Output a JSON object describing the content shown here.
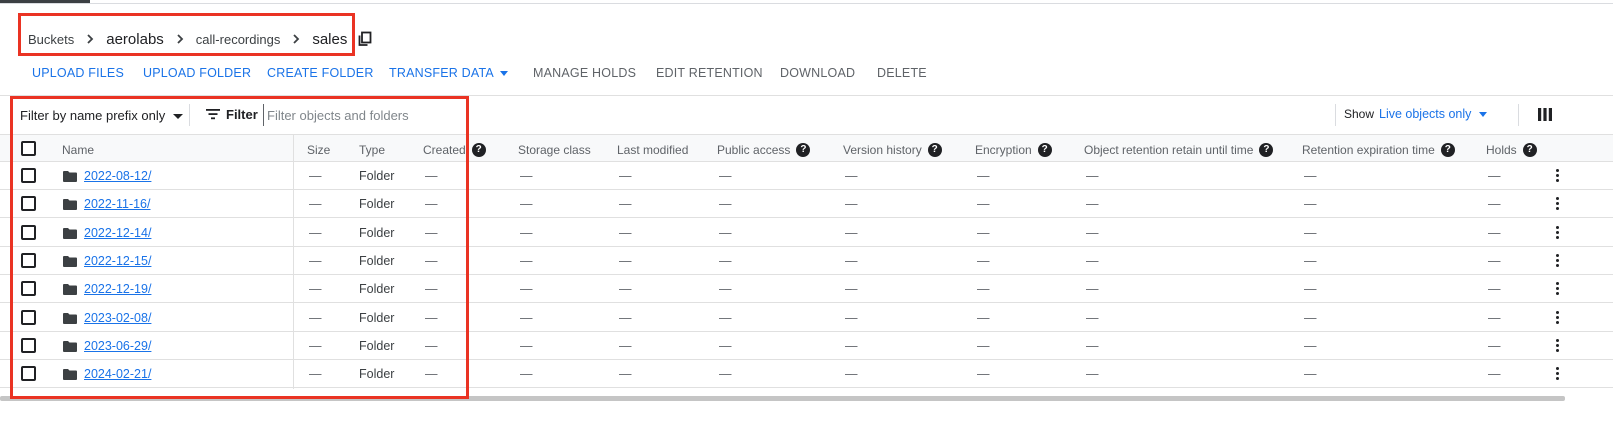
{
  "breadcrumb": {
    "items": [
      "Buckets",
      "aerolabs",
      "call-recordings",
      "sales"
    ]
  },
  "actions": {
    "upload_files": "UPLOAD FILES",
    "upload_folder": "UPLOAD FOLDER",
    "create_folder": "CREATE FOLDER",
    "transfer_data": "TRANSFER DATA",
    "manage_holds": "MANAGE HOLDS",
    "edit_retention": "EDIT RETENTION",
    "download": "DOWNLOAD",
    "delete": "DELETE"
  },
  "filter": {
    "prefix_mode": "Filter by name prefix only",
    "label": "Filter",
    "placeholder": "Filter objects and folders",
    "show_label": "Show",
    "show_value": "Live objects only"
  },
  "table": {
    "columns": {
      "name": "Name",
      "size": "Size",
      "type": "Type",
      "created": "Created",
      "storage_class": "Storage class",
      "last_modified": "Last modified",
      "public_access": "Public access",
      "version_history": "Version history",
      "encryption": "Encryption",
      "retain_until": "Object retention retain until time",
      "retention_expiration": "Retention expiration time",
      "holds": "Holds"
    },
    "empty_value": "—",
    "rows": [
      {
        "name": "2022-08-12/",
        "type": "Folder"
      },
      {
        "name": "2022-11-16/",
        "type": "Folder"
      },
      {
        "name": "2022-12-14/",
        "type": "Folder"
      },
      {
        "name": "2022-12-15/",
        "type": "Folder"
      },
      {
        "name": "2022-12-19/",
        "type": "Folder"
      },
      {
        "name": "2023-02-08/",
        "type": "Folder"
      },
      {
        "name": "2023-06-29/",
        "type": "Folder"
      },
      {
        "name": "2024-02-21/",
        "type": "Folder"
      }
    ]
  },
  "colors": {
    "accent": "#1a73e8",
    "highlight": "#ea3323"
  },
  "icons": [
    "chevron-right-icon",
    "copy-icon",
    "filter-icon",
    "help-icon",
    "folder-icon",
    "more-vert-icon",
    "columns-icon",
    "dropdown-caret-icon"
  ]
}
